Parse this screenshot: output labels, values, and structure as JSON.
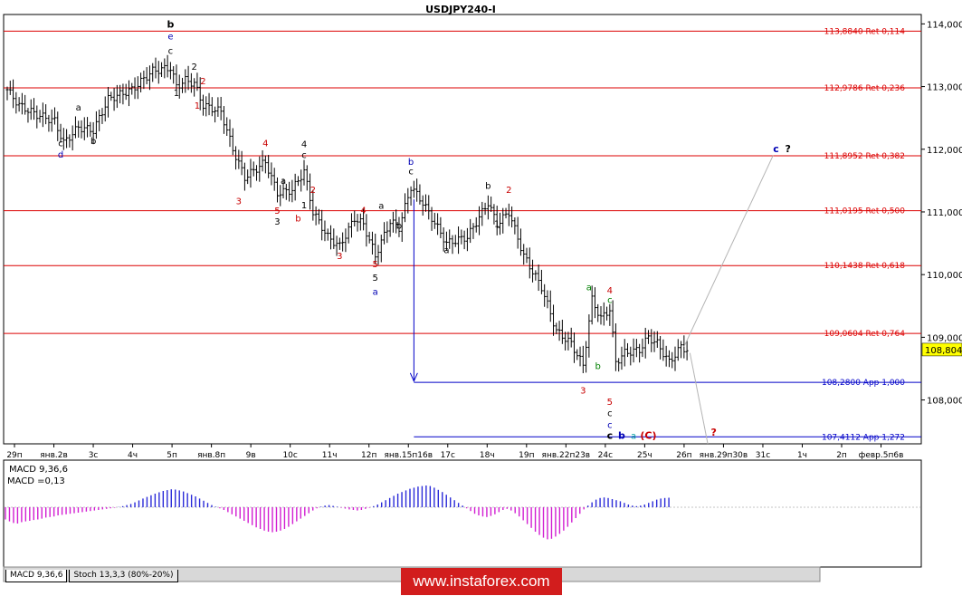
{
  "window": {
    "title": "USDJPY240-I"
  },
  "colors": {
    "fib_line": "#dc0000",
    "app_line": "#0000c8",
    "label_red": "#c80000",
    "label_blue": "#0000b4",
    "macd_positive": "#2a2ad8",
    "macd_negative": "#d21ed2",
    "trend_line": "#b4b4b4",
    "last_price_bg": "#ffff00"
  },
  "tabs": [
    {
      "label": "MACD 9,36,6",
      "active": true
    },
    {
      "label": "Stoch 13,3,3 (80%-20%)",
      "active": false
    }
  ],
  "watermark": {
    "text": "www.instaforex.com"
  },
  "chart_data": {
    "type": "candlestick",
    "symbol": "USDJPY240-I",
    "y_axis": {
      "range": [
        107.3,
        114.15
      ],
      "ticks": [
        "114,000",
        "113,000",
        "112,000",
        "111,000",
        "110,000",
        "109,000",
        "108,000"
      ],
      "tick_values": [
        114,
        113,
        112,
        111,
        110,
        109,
        108
      ]
    },
    "last_price": {
      "value": 108.804,
      "label": "108,804"
    },
    "x_axis": {
      "ticks": [
        "29п",
        "янв.2в",
        "3с",
        "4ч",
        "5п",
        "янв.8п",
        "9в",
        "10с",
        "11ч",
        "12п",
        "янв.15п16в",
        "17с",
        "18ч",
        "19п",
        "янв.22п23в",
        "24с",
        "25ч",
        "26п",
        "янв.29п30в",
        "31с",
        "1ч",
        "2п",
        "февр.5п6в"
      ]
    },
    "grid": false,
    "retracement_levels": [
      {
        "value": 113.884,
        "label": "113,8840 Ret 0,114",
        "kind": "ret"
      },
      {
        "value": 112.9786,
        "label": "112,9786 Ret 0,236",
        "kind": "ret"
      },
      {
        "value": 111.8952,
        "label": "111,8952 Ret 0,382",
        "kind": "ret"
      },
      {
        "value": 111.0195,
        "label": "111,0195 Ret 0,500",
        "kind": "ret"
      },
      {
        "value": 110.1438,
        "label": "110,1438 Ret 0,618",
        "kind": "ret"
      },
      {
        "value": 109.0604,
        "label": "109,0604 Ret 0,764",
        "kind": "ret"
      },
      {
        "value": 108.28,
        "label": "108,2800 App 1,000",
        "kind": "app"
      },
      {
        "value": 107.4112,
        "label": "107,4112 App 1,272",
        "kind": "app"
      }
    ],
    "wave_labels": [
      {
        "text": "b",
        "bar": 55,
        "price": 113.94,
        "color": "black",
        "bold": true
      },
      {
        "text": "e",
        "bar": 55,
        "price": 113.75,
        "color": "blue"
      },
      {
        "text": "c",
        "bar": 55,
        "price": 113.52,
        "color": "black"
      },
      {
        "text": "a",
        "bar": 24,
        "price": 112.62,
        "color": "black"
      },
      {
        "text": "c",
        "bar": 18,
        "price": 112.05,
        "color": "black"
      },
      {
        "text": "d",
        "bar": 18,
        "price": 111.87,
        "color": "blue"
      },
      {
        "text": "b",
        "bar": 29,
        "price": 112.08,
        "color": "black"
      },
      {
        "text": "2",
        "bar": 63,
        "price": 113.27,
        "color": "black"
      },
      {
        "text": "1",
        "bar": 57,
        "price": 112.85,
        "color": "black"
      },
      {
        "text": "2",
        "bar": 66,
        "price": 113.04,
        "color": "red"
      },
      {
        "text": "1",
        "bar": 64,
        "price": 112.65,
        "color": "red"
      },
      {
        "text": "4",
        "bar": 87,
        "price": 112.05,
        "color": "red"
      },
      {
        "text": "4",
        "bar": 100,
        "price": 112.03,
        "color": "black"
      },
      {
        "text": "c",
        "bar": 100,
        "price": 111.86,
        "color": "black"
      },
      {
        "text": "a",
        "bar": 93,
        "price": 111.45,
        "color": "black"
      },
      {
        "text": "2",
        "bar": 103,
        "price": 111.3,
        "color": "red"
      },
      {
        "text": "1",
        "bar": 100,
        "price": 111.06,
        "color": "black"
      },
      {
        "text": "3",
        "bar": 78,
        "price": 111.12,
        "color": "red"
      },
      {
        "text": "5",
        "bar": 91,
        "price": 110.97,
        "color": "red"
      },
      {
        "text": "3",
        "bar": 91,
        "price": 110.8,
        "color": "black"
      },
      {
        "text": "b",
        "bar": 98,
        "price": 110.85,
        "color": "red"
      },
      {
        "text": "4",
        "bar": 120,
        "price": 110.98,
        "color": "red"
      },
      {
        "text": "a",
        "bar": 126,
        "price": 111.05,
        "color": "black"
      },
      {
        "text": "b",
        "bar": 132,
        "price": 110.73,
        "color": "black"
      },
      {
        "text": "3",
        "bar": 112,
        "price": 110.25,
        "color": "red"
      },
      {
        "text": "5",
        "bar": 124,
        "price": 110.12,
        "color": "red"
      },
      {
        "text": "5",
        "bar": 124,
        "price": 109.9,
        "color": "black"
      },
      {
        "text": "a",
        "bar": 124,
        "price": 109.68,
        "color": "blue"
      },
      {
        "text": "b",
        "bar": 136,
        "price": 111.75,
        "color": "blue"
      },
      {
        "text": "c",
        "bar": 136,
        "price": 111.6,
        "color": "black"
      },
      {
        "text": "a",
        "bar": 148,
        "price": 110.34,
        "color": "black"
      },
      {
        "text": "b",
        "bar": 162,
        "price": 111.37,
        "color": "black"
      },
      {
        "text": "2",
        "bar": 169,
        "price": 111.3,
        "color": "red"
      },
      {
        "text": "1",
        "bar": 165,
        "price": 110.76,
        "color": "black"
      },
      {
        "text": "a",
        "bar": 196,
        "price": 109.75,
        "color": "green"
      },
      {
        "text": "4",
        "bar": 203,
        "price": 109.7,
        "color": "red"
      },
      {
        "text": "c",
        "bar": 203,
        "price": 109.55,
        "color": "green"
      },
      {
        "text": "b",
        "bar": 199,
        "price": 108.49,
        "color": "green"
      },
      {
        "text": "3",
        "bar": 194,
        "price": 108.1,
        "color": "red"
      },
      {
        "text": "5",
        "bar": 203,
        "price": 107.92,
        "color": "red"
      },
      {
        "text": "c",
        "bar": 203,
        "price": 107.74,
        "color": "black"
      },
      {
        "text": "c",
        "bar": 203,
        "price": 107.55,
        "color": "blue"
      },
      {
        "text": "c",
        "bar": 203,
        "price": 107.38,
        "color": "black",
        "bold": true
      },
      {
        "text": "b",
        "bar": 207,
        "price": 107.38,
        "color": "blue",
        "bold": true
      },
      {
        "text": "a",
        "bar": 211,
        "price": 107.38,
        "color": "teal"
      },
      {
        "text": "(C)",
        "bar": 216,
        "price": 107.38,
        "color": "red",
        "bold": true
      },
      {
        "text": "c",
        "bar": 259,
        "price": 111.95,
        "color": "blue",
        "bold": true
      },
      {
        "text": "?",
        "bar": 263,
        "price": 111.95,
        "color": "black",
        "bold": true
      },
      {
        "text": "?",
        "bar": 238,
        "price": 107.43,
        "color": "red",
        "bold": true
      }
    ],
    "projection_lines": [
      {
        "from_bar": 228,
        "from_price": 108.85,
        "to_bar": 258,
        "to_price": 111.9
      },
      {
        "from_bar": 230,
        "from_price": 108.75,
        "to_bar": 236,
        "to_price": 107.3
      }
    ],
    "arrow": {
      "bar": 137,
      "from_price": 111.2,
      "to_price": 108.3
    },
    "indicator": {
      "name": "MACD 9,36,6",
      "value_label": "MACD =0,13",
      "zero_line": true,
      "values": [
        -0.45,
        -0.52,
        -0.58,
        -0.6,
        -0.55,
        -0.52,
        -0.5,
        -0.47,
        -0.45,
        -0.42,
        -0.38,
        -0.36,
        -0.34,
        -0.3,
        -0.28,
        -0.26,
        -0.24,
        -0.22,
        -0.2,
        -0.18,
        -0.16,
        -0.14,
        -0.12,
        -0.1,
        -0.08,
        -0.06,
        -0.04,
        -0.02,
        0.01,
        0.04,
        0.08,
        0.12,
        0.18,
        0.25,
        0.32,
        0.38,
        0.44,
        0.5,
        0.55,
        0.6,
        0.63,
        0.66,
        0.65,
        0.62,
        0.58,
        0.52,
        0.46,
        0.4,
        0.32,
        0.24,
        0.16,
        0.08,
        0.02,
        -0.04,
        -0.1,
        -0.18,
        -0.26,
        -0.34,
        -0.42,
        -0.5,
        -0.58,
        -0.66,
        -0.74,
        -0.8,
        -0.86,
        -0.9,
        -0.92,
        -0.9,
        -0.86,
        -0.8,
        -0.72,
        -0.62,
        -0.52,
        -0.42,
        -0.32,
        -0.22,
        -0.12,
        -0.04,
        0.02,
        0.06,
        0.08,
        0.05,
        0.02,
        -0.02,
        -0.05,
        -0.08,
        -0.1,
        -0.12,
        -0.1,
        -0.06,
        -0.02,
        0.04,
        0.1,
        0.18,
        0.26,
        0.34,
        0.42,
        0.5,
        0.56,
        0.62,
        0.68,
        0.72,
        0.76,
        0.78,
        0.8,
        0.78,
        0.72,
        0.64,
        0.56,
        0.46,
        0.36,
        0.26,
        0.16,
        0.06,
        -0.04,
        -0.14,
        -0.24,
        -0.3,
        -0.34,
        -0.36,
        -0.32,
        -0.26,
        -0.18,
        -0.1,
        -0.06,
        -0.12,
        -0.22,
        -0.34,
        -0.48,
        -0.62,
        -0.76,
        -0.9,
        -1.02,
        -1.12,
        -1.18,
        -1.16,
        -1.08,
        -0.98,
        -0.86,
        -0.72,
        -0.56,
        -0.4,
        -0.24,
        -0.08,
        0.06,
        0.18,
        0.28,
        0.34,
        0.36,
        0.34,
        0.3,
        0.26,
        0.22,
        0.16,
        0.1,
        0.06,
        0.04,
        0.06,
        0.1,
        0.16,
        0.22,
        0.28,
        0.32,
        0.34,
        0.35
      ]
    }
  }
}
